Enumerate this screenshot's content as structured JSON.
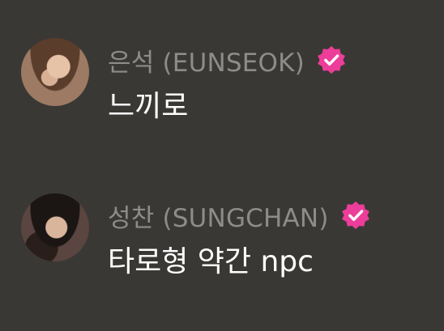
{
  "messages": [
    {
      "author": "은석 (EUNSEOK)",
      "text": "느끼로",
      "avatar_icon": "person-photo-avatar",
      "badge_icon": "verified-checkmark-icon"
    },
    {
      "author": "성찬 (SUNGCHAN)",
      "text": "타로형 약간 npc",
      "avatar_icon": "person-photo-avatar",
      "badge_icon": "verified-checkmark-icon"
    }
  ],
  "colors": {
    "background": "#3a3834",
    "author_name": "#8e8c88",
    "message_text": "#ffffff",
    "verified_badge": "#ec3d9a"
  }
}
